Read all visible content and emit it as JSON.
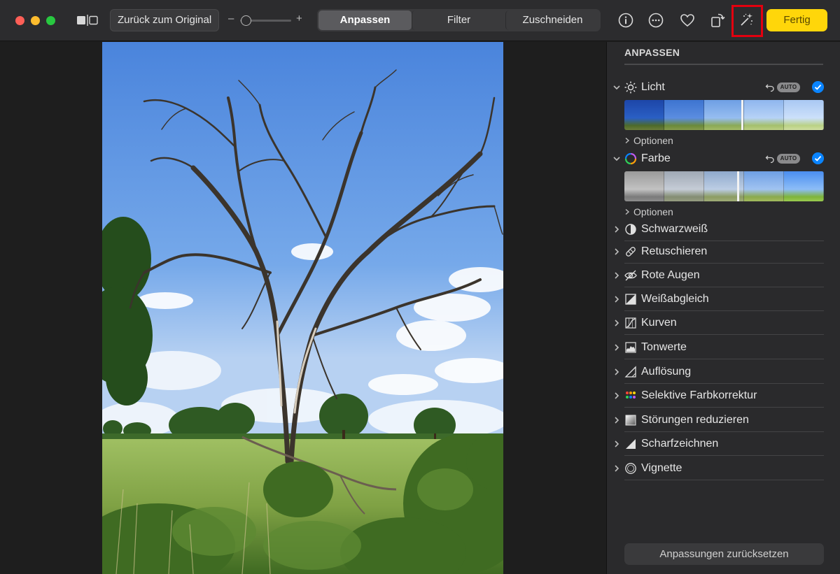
{
  "toolbar": {
    "revert_label": "Zurück zum Original",
    "zoom_minus": "–",
    "zoom_plus": "+",
    "tabs": [
      {
        "label": "Anpassen",
        "active": true
      },
      {
        "label": "Filter",
        "active": false
      },
      {
        "label": "Zuschneiden",
        "active": false
      }
    ],
    "icons": [
      "info-icon",
      "more-icon",
      "heart-icon",
      "rotate-icon",
      "magic-wand-icon"
    ],
    "done_label": "Fertig",
    "done_color": "#ffd60a",
    "highlight_color": "#e3000f"
  },
  "sidebar": {
    "title": "ANPASSEN",
    "licht": {
      "label": "Licht",
      "auto": "AUTO",
      "options": "Optionen"
    },
    "farbe": {
      "label": "Farbe",
      "auto": "AUTO",
      "options": "Optionen"
    },
    "items": [
      {
        "label": "Schwarzweiß",
        "icon": "half-circle-icon"
      },
      {
        "label": "Retuschieren",
        "icon": "bandage-icon"
      },
      {
        "label": "Rote Augen",
        "icon": "eye-icon"
      },
      {
        "label": "Weißabgleich",
        "icon": "white-balance-icon"
      },
      {
        "label": "Kurven",
        "icon": "curves-icon"
      },
      {
        "label": "Tonwerte",
        "icon": "levels-icon"
      },
      {
        "label": "Auflösung",
        "icon": "definition-icon"
      },
      {
        "label": "Selektive Farbkorrektur",
        "icon": "color-dots-icon"
      },
      {
        "label": "Störungen reduzieren",
        "icon": "noise-icon"
      },
      {
        "label": "Scharfzeichnen",
        "icon": "sharpen-icon"
      },
      {
        "label": "Vignette",
        "icon": "vignette-icon"
      }
    ],
    "reset_label": "Anpassungen zurücksetzen",
    "accent": "#0a84ff"
  }
}
